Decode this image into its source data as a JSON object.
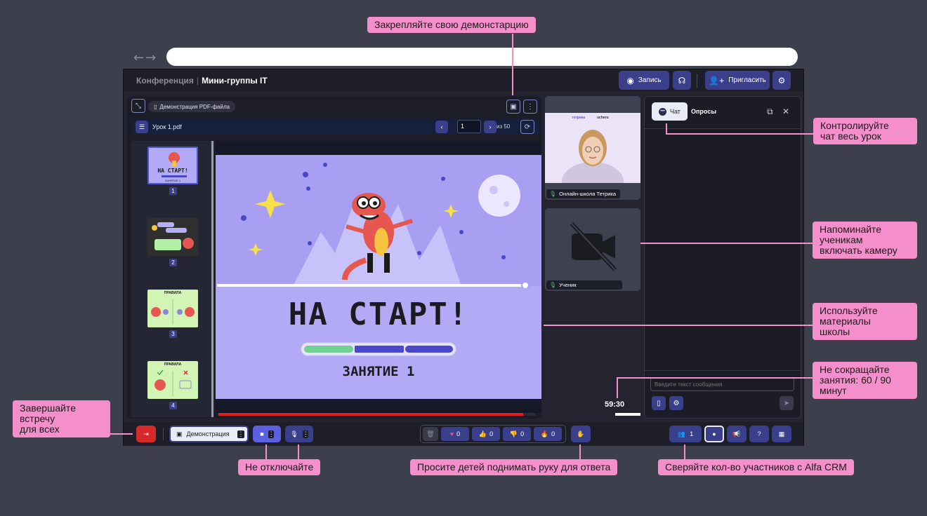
{
  "browser": {
    "nav": "←→"
  },
  "header": {
    "breadcrumb_parent": "Конференция",
    "breadcrumb_current": "Мини-группы IT",
    "record_label": "Запись",
    "invite_label": "Пригласить"
  },
  "presentation": {
    "tab_label": "Демонстрация PDF-файла",
    "file_name": "Урок 1.pdf",
    "page_value": "1",
    "page_total": "из 50",
    "thumbnails": [
      "1",
      "2",
      "3",
      "4"
    ],
    "thumb1_title": "НА СТАРТ!",
    "thumb1_sub": "ЗАНЯТИЕ 1",
    "thumb3_title": "ПРАВИЛА",
    "thumb4_title": "ПРАВИЛА",
    "slide_title": "НА СТАРТ!",
    "slide_subtitle": "ЗАНЯТИЕ 1",
    "progress": 0.96
  },
  "tiles": {
    "teacher_name": "Онлайн-школа Тетрика",
    "teacher_logo_a": "тетрика",
    "teacher_logo_b": "ucheru",
    "student_name": "Ученик"
  },
  "timer": "59:30",
  "chat": {
    "tab_chat": "Чат",
    "tab_polls": "Опросы",
    "input_placeholder": "Введите текст сообщения"
  },
  "bottombar": {
    "demo_label": "Демонстрация",
    "reactions": [
      {
        "icon": "heart-icon",
        "glyph": "♥",
        "count": "0",
        "color": "#e94e8a"
      },
      {
        "icon": "thumbs-up-icon",
        "glyph": "👍",
        "count": "0",
        "color": "#58c46b"
      },
      {
        "icon": "thumbs-down-icon",
        "glyph": "👎",
        "count": "0",
        "color": "#e23030"
      },
      {
        "icon": "fire-icon",
        "glyph": "🔥",
        "count": "0",
        "color": "#f2a23a"
      }
    ],
    "participants_count": "1"
  },
  "annotations": {
    "pin": "Закрепляйте свою демонстарцию",
    "chat": "Контролируйте\nчат весь урок",
    "camera": "Напоминайте\nученикам\nвключать камеру",
    "materials": "Используйте\nматериалы\nшколы",
    "duration": "Не сокращайте\nзанятия: 60 / 90\nминут",
    "end": "Завершайте\nвстречу\nдля всех",
    "mic": "Не отключайте",
    "hand": "Просите детей поднимать руку для ответа",
    "crm": "Сверяйте кол-во участников с Alfa CRM"
  },
  "colors": {
    "accent": "#3a3f8c",
    "annotation": "#f58fcb",
    "danger": "#d62a2a",
    "slide_bg": "#b3aaf5"
  }
}
